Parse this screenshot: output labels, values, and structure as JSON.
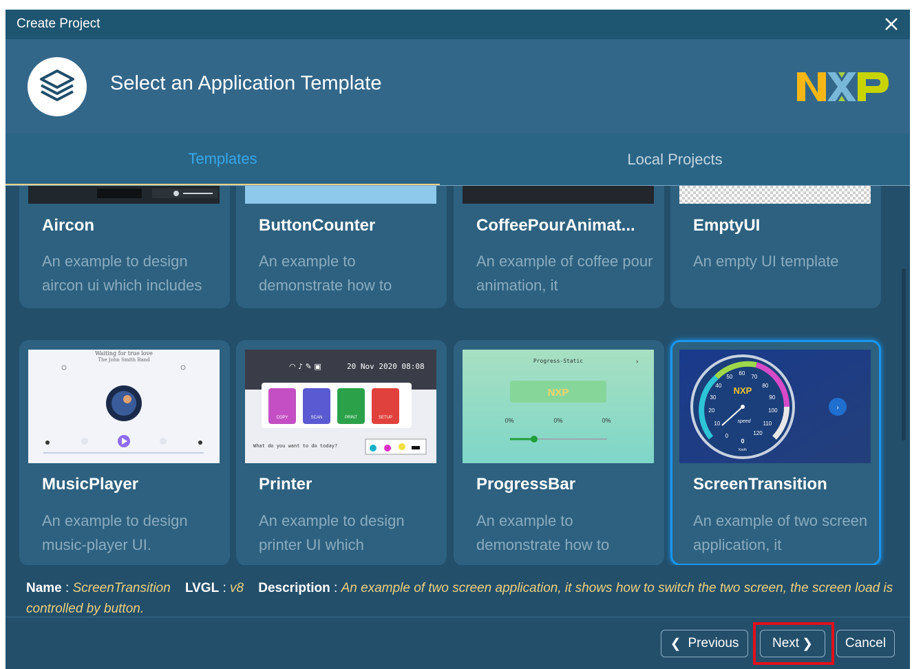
{
  "window": {
    "title": "Create Project"
  },
  "header": {
    "heading": "Select an Application Template",
    "brand": "NXP"
  },
  "tabs": [
    {
      "label": "Templates",
      "active": true
    },
    {
      "label": "Local Projects",
      "active": false
    }
  ],
  "templates": [
    {
      "name": "Aircon",
      "desc": "An example to design aircon ui which includes"
    },
    {
      "name": "ButtonCounter",
      "desc": "An example to demonstrate how to"
    },
    {
      "name": "CoffeePourAnimat...",
      "desc": "An example of coffee pour animation, it"
    },
    {
      "name": "EmptyUI",
      "desc": "An empty UI template"
    },
    {
      "name": "MusicPlayer",
      "desc": "An example to design music-player UI."
    },
    {
      "name": "Printer",
      "desc": "An example to design printer UI which"
    },
    {
      "name": "ProgressBar",
      "desc": "An example to demonstrate how to"
    },
    {
      "name": "ScreenTransition",
      "desc": "An example of two screen application, it",
      "selected": true
    }
  ],
  "thumbs": {
    "music_title": "Waiting for true love",
    "music_artist": "The John Smith Band",
    "printer_date": "20 Nov 2020 08:08",
    "printer_labels": [
      "COPY",
      "SCAN",
      "PRINT",
      "SETUP"
    ],
    "printer_question": "What do you want to do today?",
    "progress_title": "Progress-Static",
    "progress_values": [
      "0%",
      "0%",
      "0%"
    ],
    "gauge_label": "speed",
    "gauge_value": "0",
    "gauge_unit": "Km/h",
    "gauge_ticks": [
      "0",
      "10",
      "20",
      "30",
      "40",
      "50",
      "60",
      "70",
      "80",
      "90",
      "100",
      "110",
      "120"
    ]
  },
  "info": {
    "name_label": "Name",
    "name_value": "ScreenTransition",
    "lvgl_label": "LVGL",
    "lvgl_value": "v8",
    "desc_label": "Description",
    "desc_value": "An example of two screen application, it shows how to switch the two screen, the screen load is controlled by button."
  },
  "buttons": {
    "previous": "Previous",
    "next": "Next",
    "cancel": "Cancel"
  },
  "colors": {
    "accent": "#1996f0",
    "tab_active": "#37a7e8",
    "highlight": "#e0101a"
  }
}
